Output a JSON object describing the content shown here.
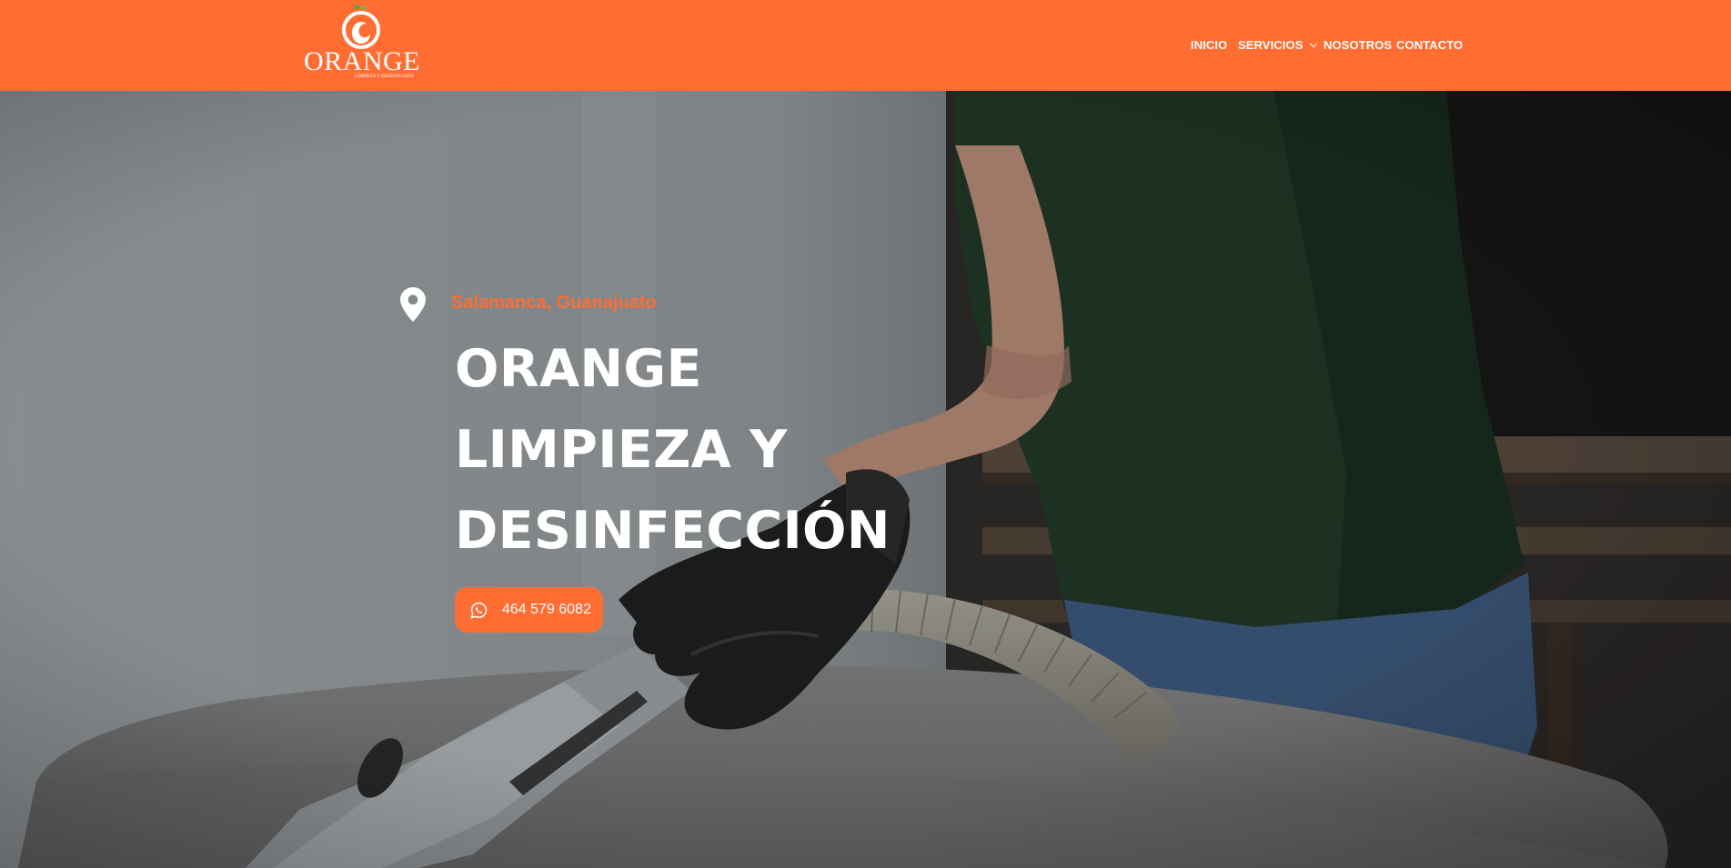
{
  "brand": {
    "name": "ORANGE",
    "tagline": "LIMPIEZA Y DESINFECCIÓN",
    "color": "#ff6d33",
    "logo_icon": "orange-logo-icon"
  },
  "nav": {
    "items": [
      {
        "label": "INICIO"
      },
      {
        "label": "SERVICIOS",
        "icon": "chevron-down-icon"
      },
      {
        "label": "NOSOTROS"
      },
      {
        "label": "CONTACTO"
      }
    ]
  },
  "hero": {
    "background": "photo-person-vacuuming-sofa",
    "location_icon": "map-pin-icon",
    "location": "Salamanca, Guanajuato",
    "title_lines": [
      "ORANGE",
      "LIMPIEZA Y",
      "DESINFECCIÓN"
    ],
    "cta": {
      "icon": "whatsapp-icon",
      "label": "464 579 6082"
    }
  }
}
